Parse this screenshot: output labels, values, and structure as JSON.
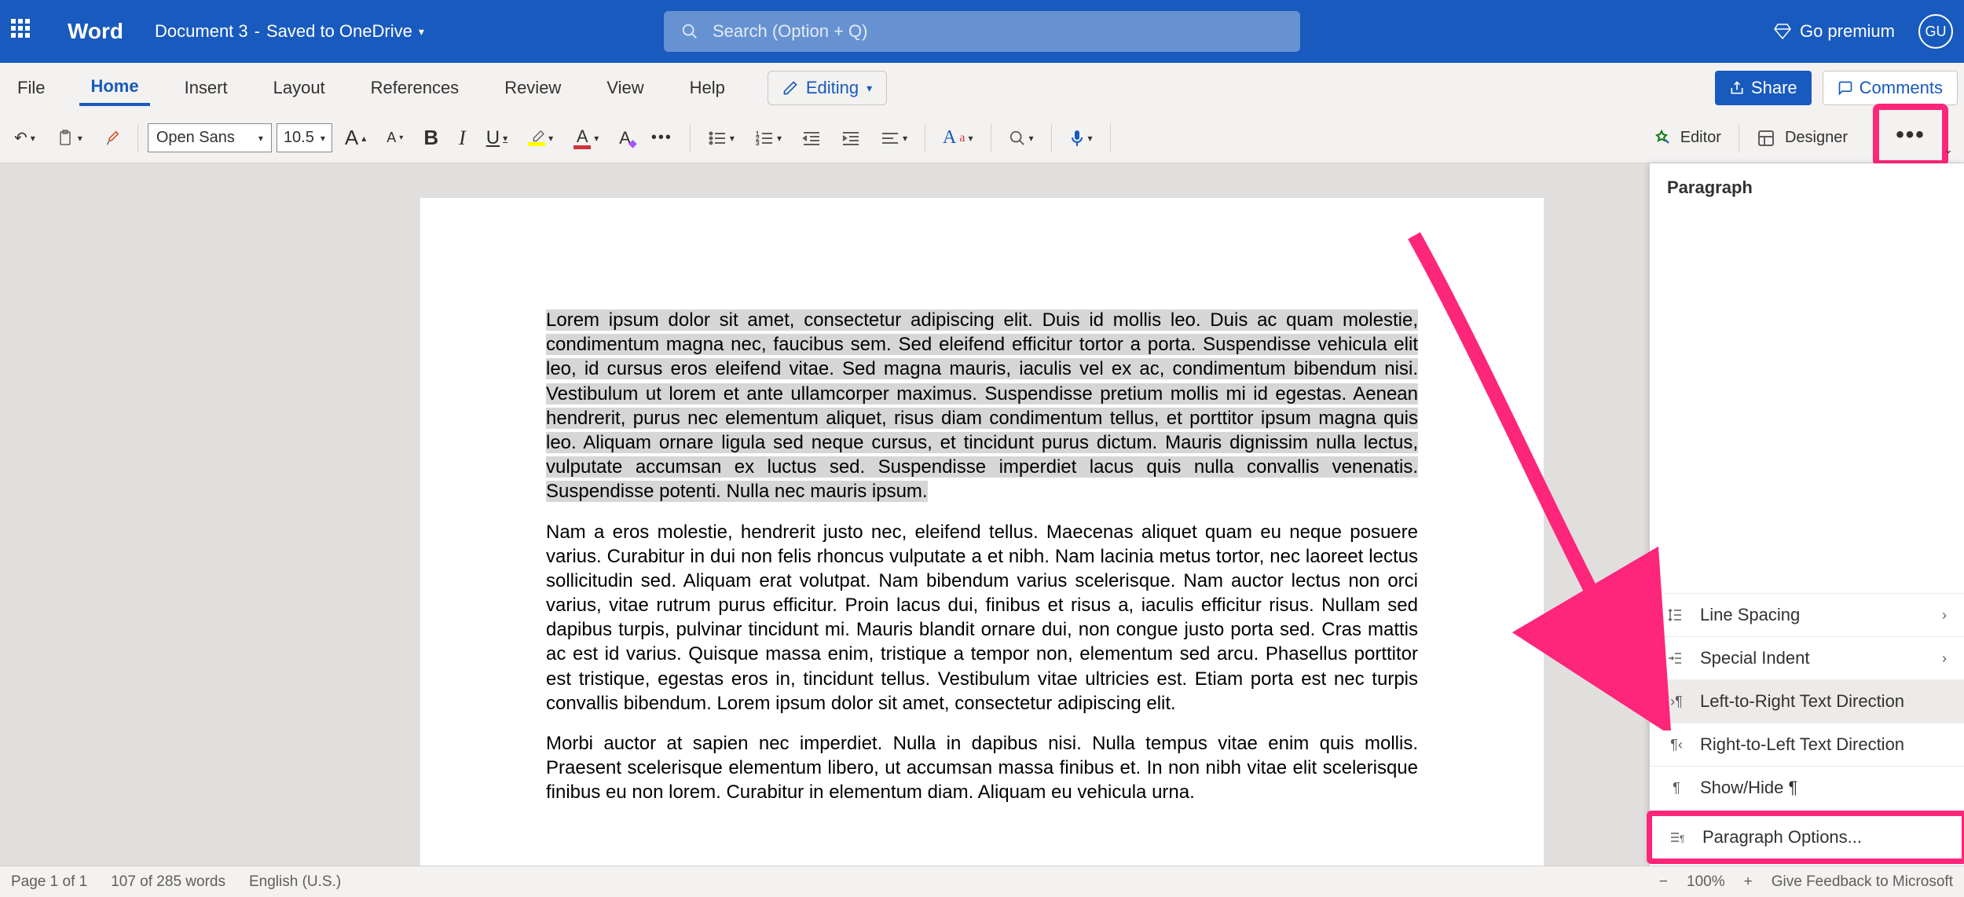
{
  "title": {
    "app": "Word",
    "doc": "Document 3",
    "status": "Saved to OneDrive"
  },
  "search": {
    "placeholder": "Search (Option + Q)"
  },
  "premium": "Go premium",
  "avatar": "GU",
  "menu": {
    "file": "File",
    "home": "Home",
    "insert": "Insert",
    "layout": "Layout",
    "references": "References",
    "review": "Review",
    "view": "View",
    "help": "Help",
    "editing": "Editing",
    "share": "Share",
    "comments": "Comments"
  },
  "ribbon": {
    "font": "Open Sans",
    "size": "10.5",
    "editor": "Editor",
    "designer": "Designer"
  },
  "panel": {
    "title": "Paragraph",
    "items": {
      "line": "Line Spacing",
      "indent": "Special Indent",
      "ltr": "Left-to-Right Text Direction",
      "rtl": "Right-to-Left Text Direction",
      "show": "Show/Hide ¶",
      "opts": "Paragraph Options..."
    }
  },
  "status": {
    "page": "Page 1 of 1",
    "words": "107 of 285 words",
    "lang": "English (U.S.)",
    "zoom": "100%",
    "feedback": "Give Feedback to Microsoft"
  },
  "doc": {
    "p1_a": "Lorem ipsum dolor sit amet, consectetur adipiscing elit. Duis id mollis leo. Duis ac quam molestie, condimentum magna nec, faucibus sem. Sed eleifend efficitur tortor a porta. Suspendisse vehicula elit leo, id cursus eros eleifend vitae. Sed magna mauris, iaculis vel ex ac, condimentum bibendum nisi. Vestibulum ut lorem et ante ullamcorper maximus. Suspendisse pretium mollis mi id egestas. Aenean hendrerit, purus nec elementum aliquet, risus diam condimentum tellus, et porttitor ipsum magna quis leo. Aliquam ornare ligula sed neque cursus, et tincidunt purus dictum. Mauris dignissim nulla lectus, vulputate accumsan ex luctus sed. Suspendisse imperdiet lacus quis nulla convallis venenatis. Suspendisse potenti. Nulla nec mauris ipsum.",
    "p2": "Nam a eros molestie, hendrerit justo nec, eleifend tellus. Maecenas aliquet quam eu neque posuere varius. Curabitur in dui non felis rhoncus vulputate a et nibh. Nam lacinia metus tortor, nec laoreet lectus sollicitudin sed. Aliquam erat volutpat. Nam bibendum varius scelerisque. Nam auctor lectus non orci varius, vitae rutrum purus efficitur. Proin lacus dui, finibus et risus a, iaculis efficitur risus. Nullam sed dapibus turpis, pulvinar tincidunt mi. Mauris blandit ornare dui, non congue justo porta sed. Cras mattis ac est id varius. Quisque massa enim, tristique a tempor non, elementum sed arcu. Phasellus porttitor est tristique, egestas eros in, tincidunt tellus. Vestibulum vitae ultricies est. Etiam porta est nec turpis convallis bibendum. Lorem ipsum dolor sit amet, consectetur adipiscing elit.",
    "p3": "Morbi auctor at sapien nec imperdiet. Nulla in dapibus nisi. Nulla tempus vitae enim quis mollis. Praesent scelerisque elementum libero, ut accumsan massa finibus et. In non nibh vitae elit scelerisque finibus eu non lorem. Curabitur in elementum diam. Aliquam eu vehicula urna."
  }
}
